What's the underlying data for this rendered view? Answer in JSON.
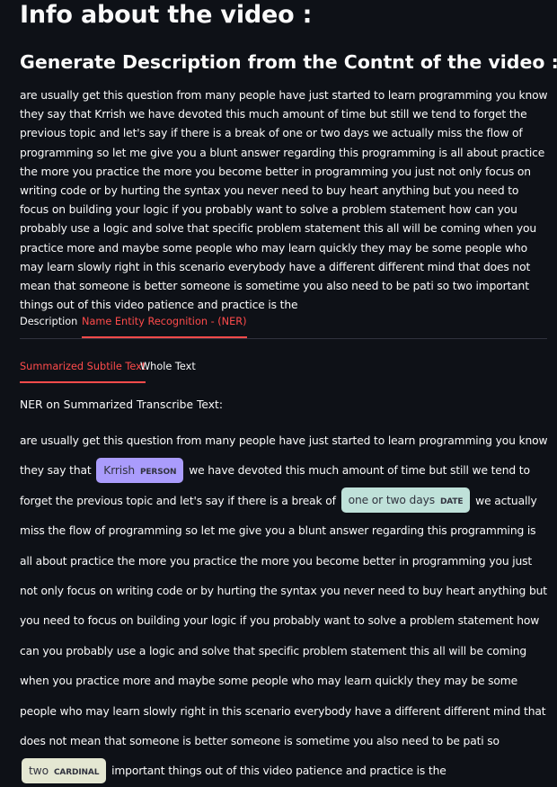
{
  "title": "Info about the video :",
  "subtitle": "Generate Description from the Contnt of the video :",
  "description_text": "are usually get this question from many people have just started to learn programming you know they say that Krrish we have devoted this much amount of time but still we tend to forget the previous topic and let's say if there is a break of one or two days we actually miss the flow of programming so let me give you a blunt answer regarding this programming is all about practice the more you practice the more you become better in programming you just not only focus on writing code or by hurting the syntax you never need to buy heart anything but you need to focus on building your logic if you probably want to solve a problem statement how can you probably use a logic and solve that specific problem statement this all will be coming when you practice more and maybe some people who may learn quickly they may be some people who may learn slowly right in this scenario everybody have a different different mind that does not mean that someone is better someone is sometime you also need to be pati so two important things out of this video patience and practice is the",
  "main_tabs": {
    "description": "Description",
    "ner": "Name Entity Recognition - (NER)"
  },
  "sub_tabs": {
    "summarized": "Summarized Subtile Text",
    "whole": "Whole Text"
  },
  "ner_heading": "NER on Summarized Transcribe Text:",
  "ner_segments": {
    "s1": "are usually get this question from many people have just started to learn programming you know they say that",
    "e1_text": "Krrish",
    "e1_label": "PERSON",
    "s2": "we have devoted this much amount of time but still we tend to forget the previous topic and let's say if there is a break of",
    "e2_text": "one or two days",
    "e2_label": "DATE",
    "s3": "we actually miss the flow of programming so let me give you a blunt answer regarding this programming is all about practice the more you practice the more you become better in programming you just not only focus on writing code or by hurting the syntax you never need to buy heart anything but you need to focus on building your logic if you probably want to solve a problem statement how can you probably use a logic and solve that specific problem statement this all will be coming when you practice more and maybe some people who may learn quickly they may be some people who may learn slowly right in this scenario everybody have a different different mind that does not mean that someone is better someone is sometime you also need to be pati so",
    "e3_text": "two",
    "e3_label": "CARDINAL",
    "s4": "important things out of this video patience and practice is the"
  },
  "colors": {
    "background": "#0e1117",
    "accent": "#ff4b4b",
    "person": "#aa9cfc",
    "date": "#bfe1d9",
    "cardinal": "#e4e7d2"
  }
}
